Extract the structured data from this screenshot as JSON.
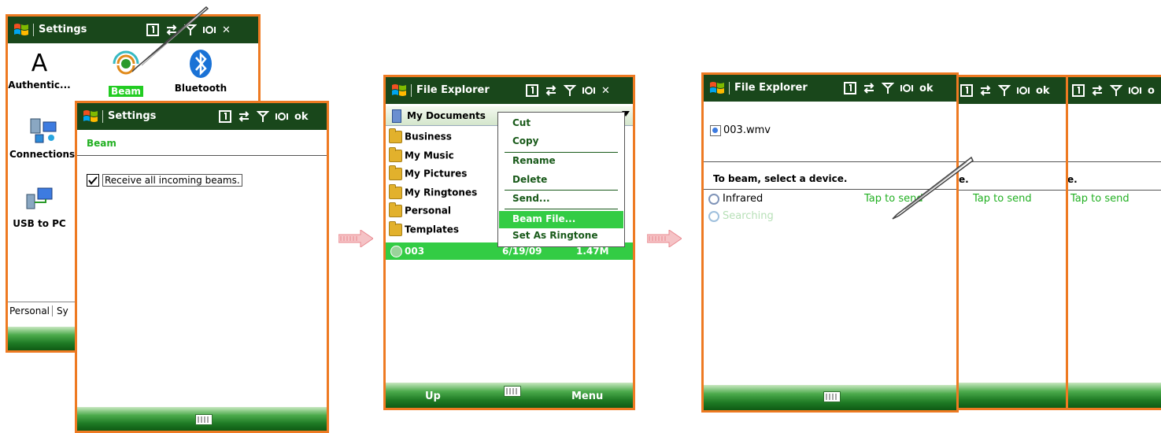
{
  "screen1": {
    "title": "Settings",
    "icons": [
      {
        "label": "Authentic...",
        "icon": "letter-a-icon",
        "glyph": "A"
      },
      {
        "label": "Beam",
        "icon": "beam-icon"
      },
      {
        "label": "Bluetooth",
        "icon": "bluetooth-icon"
      },
      {
        "label": "Connections",
        "icon": "connections-icon"
      },
      {
        "label": "USB to PC",
        "icon": "usb-to-pc-icon"
      }
    ],
    "tabs": [
      "Personal",
      "Sy"
    ]
  },
  "screen2": {
    "title": "Settings",
    "ok": "ok",
    "section": "Beam",
    "checkbox_label": "Receive all incoming beams."
  },
  "screen3": {
    "title": "File Explorer",
    "folder_dropdown": "My Documents",
    "folders": [
      "Business",
      "My Music",
      "My Pictures",
      "My Ringtones",
      "Personal",
      "Templates"
    ],
    "selected_file": {
      "name": "003",
      "date": "6/19/09",
      "size": "1.47M"
    },
    "context_menu": [
      "Cut",
      "Copy",
      "Rename",
      "Delete",
      "Send...",
      "Beam File...",
      "Set As Ringtone"
    ],
    "softkey_left": "Up",
    "softkey_right": "Menu"
  },
  "screen4": {
    "title": "File Explorer",
    "ok": "ok",
    "file_name": "003.wmv",
    "prompt": "To beam, select a device.",
    "device": "Infrared",
    "tap_to_send": "Tap to send",
    "searching": "Searching",
    "overlay_prompt": "e.",
    "overlay_ok": "ok",
    "overlay_ok_partial": "o"
  },
  "colors": {
    "frame": "#ee7a22",
    "titlebar": "#19471b",
    "accent_green": "#22cc22",
    "arrow": "#e9888f"
  }
}
